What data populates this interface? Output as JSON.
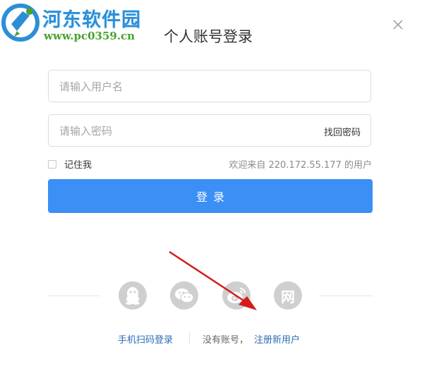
{
  "watermark": {
    "title": "河东软件园",
    "url": "www.pc0359.cn"
  },
  "dialog": {
    "title": "个人账号登录",
    "close_icon": "close-icon"
  },
  "form": {
    "username_placeholder": "请输入用户名",
    "username_value": "",
    "password_placeholder": "请输入密码",
    "password_value": "",
    "forgot_password": "找回密码",
    "remember_me": "记住我",
    "remember_checked": false,
    "welcome": "欢迎来自 220.172.55.177 的用户",
    "login_button": "登录"
  },
  "social": {
    "icons": [
      "qq-icon",
      "wechat-icon",
      "weibo-icon",
      "netease-icon"
    ],
    "netease_glyph": "网"
  },
  "footer": {
    "phone_login": "手机扫码登录",
    "no_account": "没有账号，",
    "register": "注册新用户"
  },
  "colors": {
    "primary_button": "#3b8ff5",
    "link": "#2d6cb5",
    "social_icon_bg": "#cfcfcf",
    "annotation_arrow": "#d31c1c"
  }
}
